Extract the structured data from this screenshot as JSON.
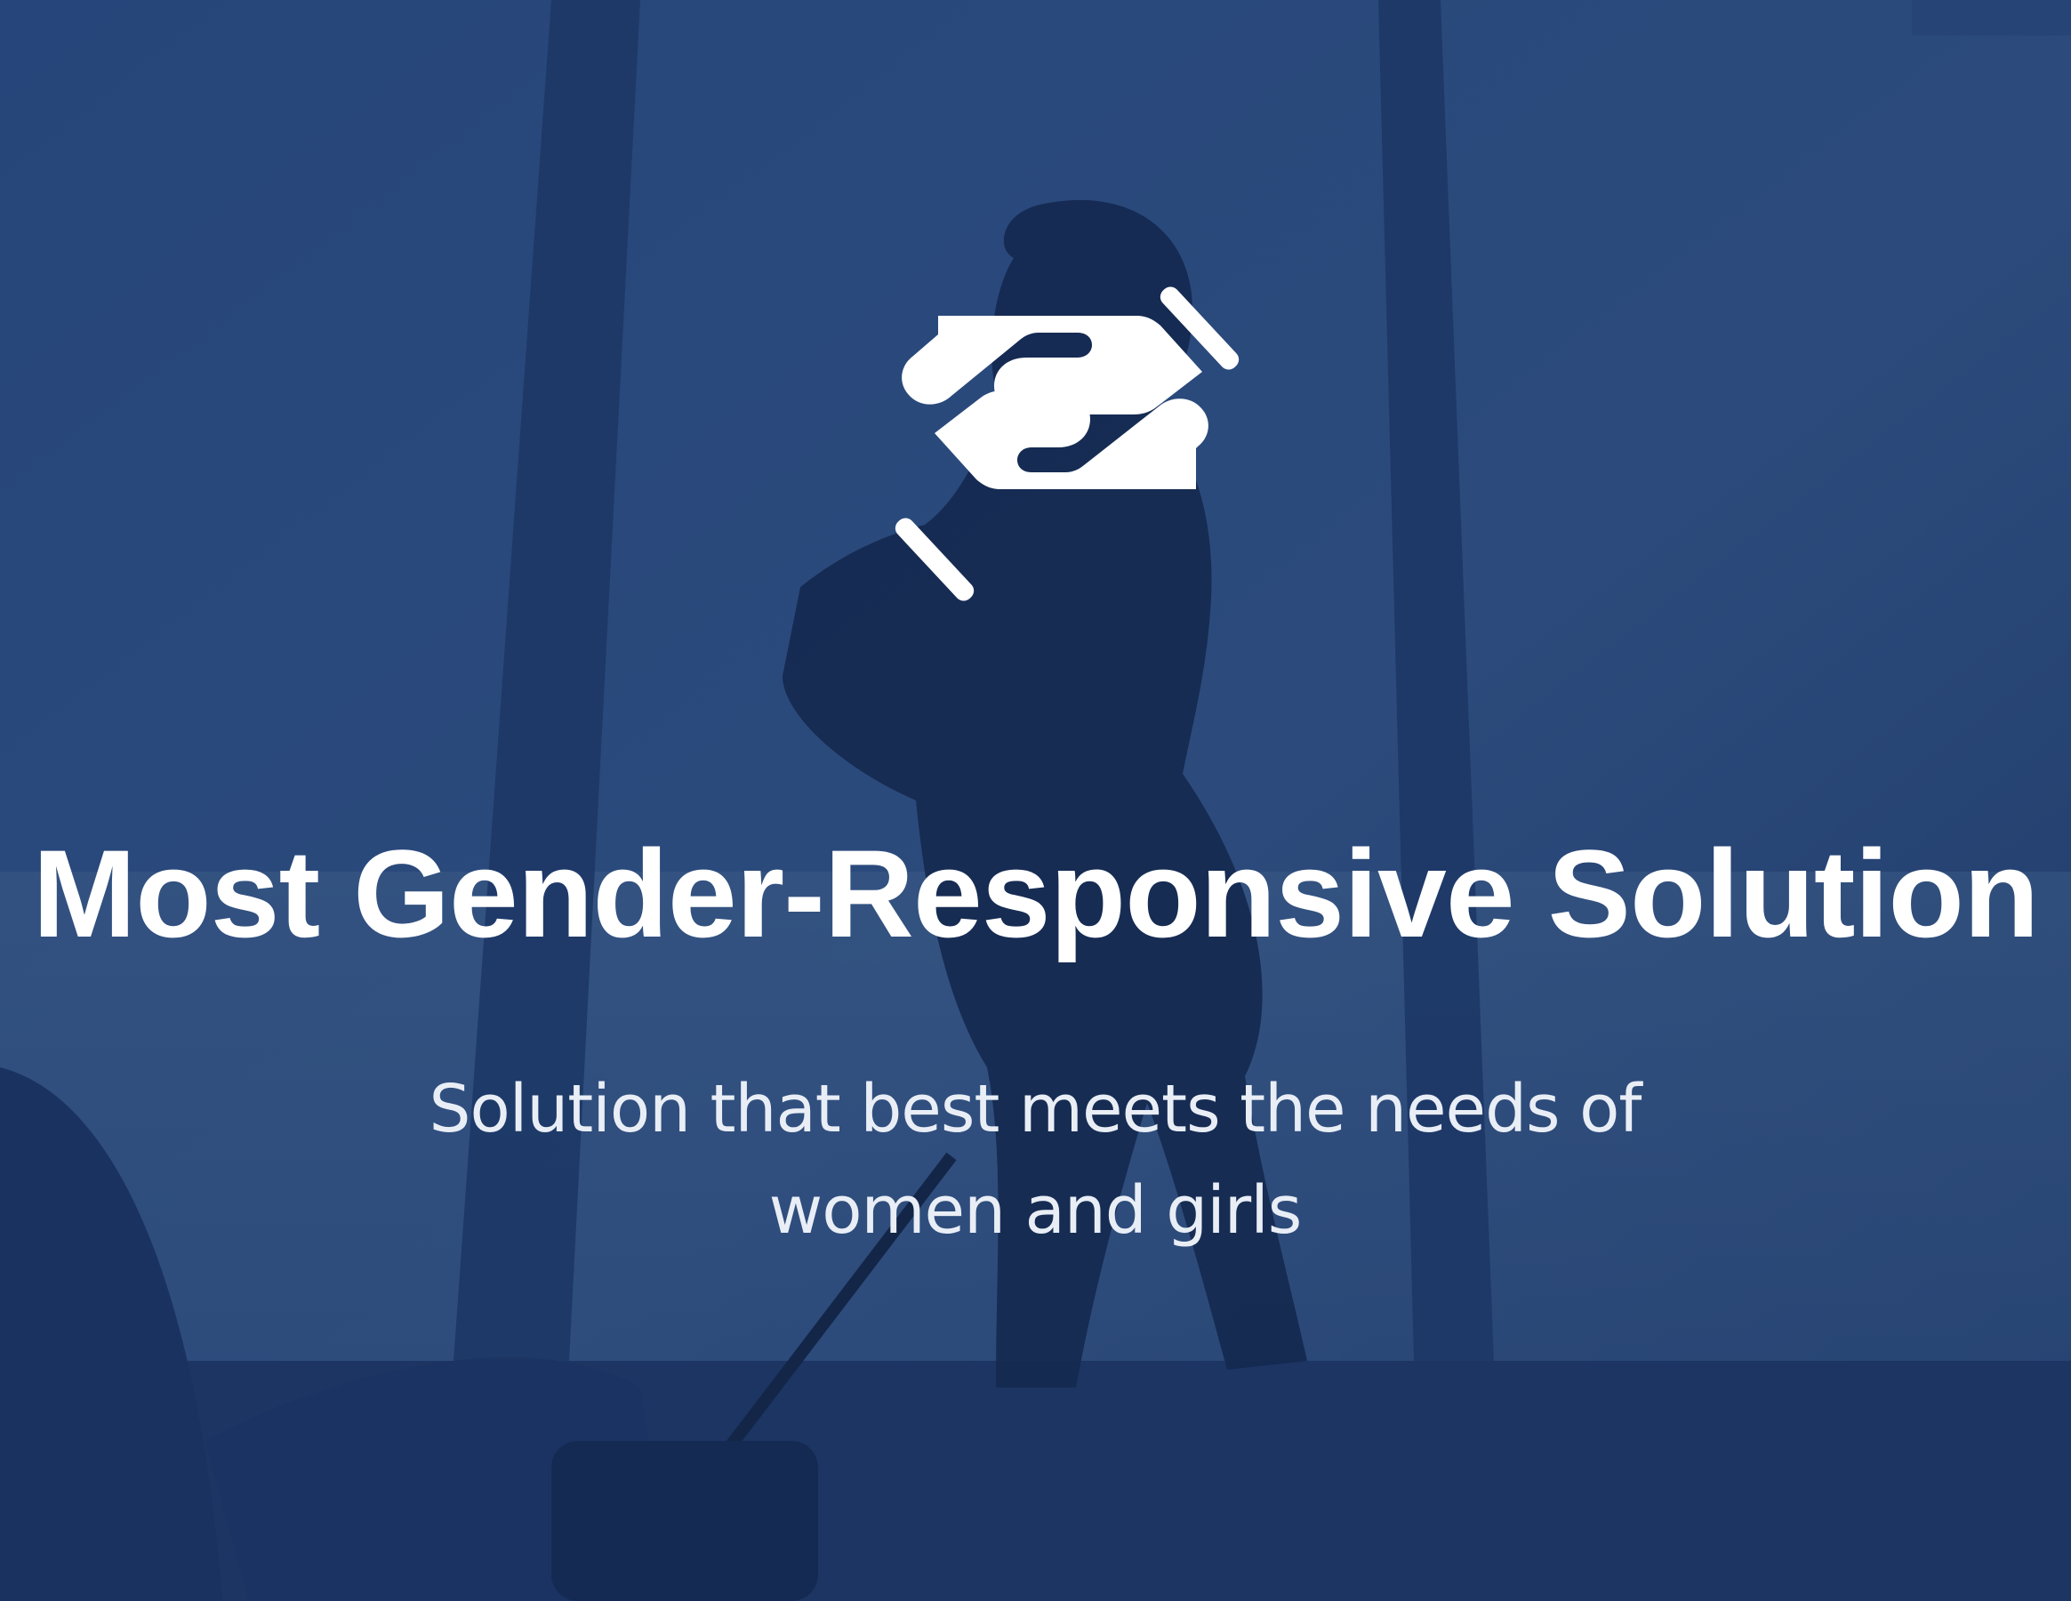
{
  "slide": {
    "title": "Most Gender-Responsive Solution",
    "subtitle": "Solution that best meets the needs of women and girls",
    "icon": "helping-hands-icon"
  },
  "colors": {
    "overlay": "#1f3c6e",
    "text": "#ffffff"
  }
}
